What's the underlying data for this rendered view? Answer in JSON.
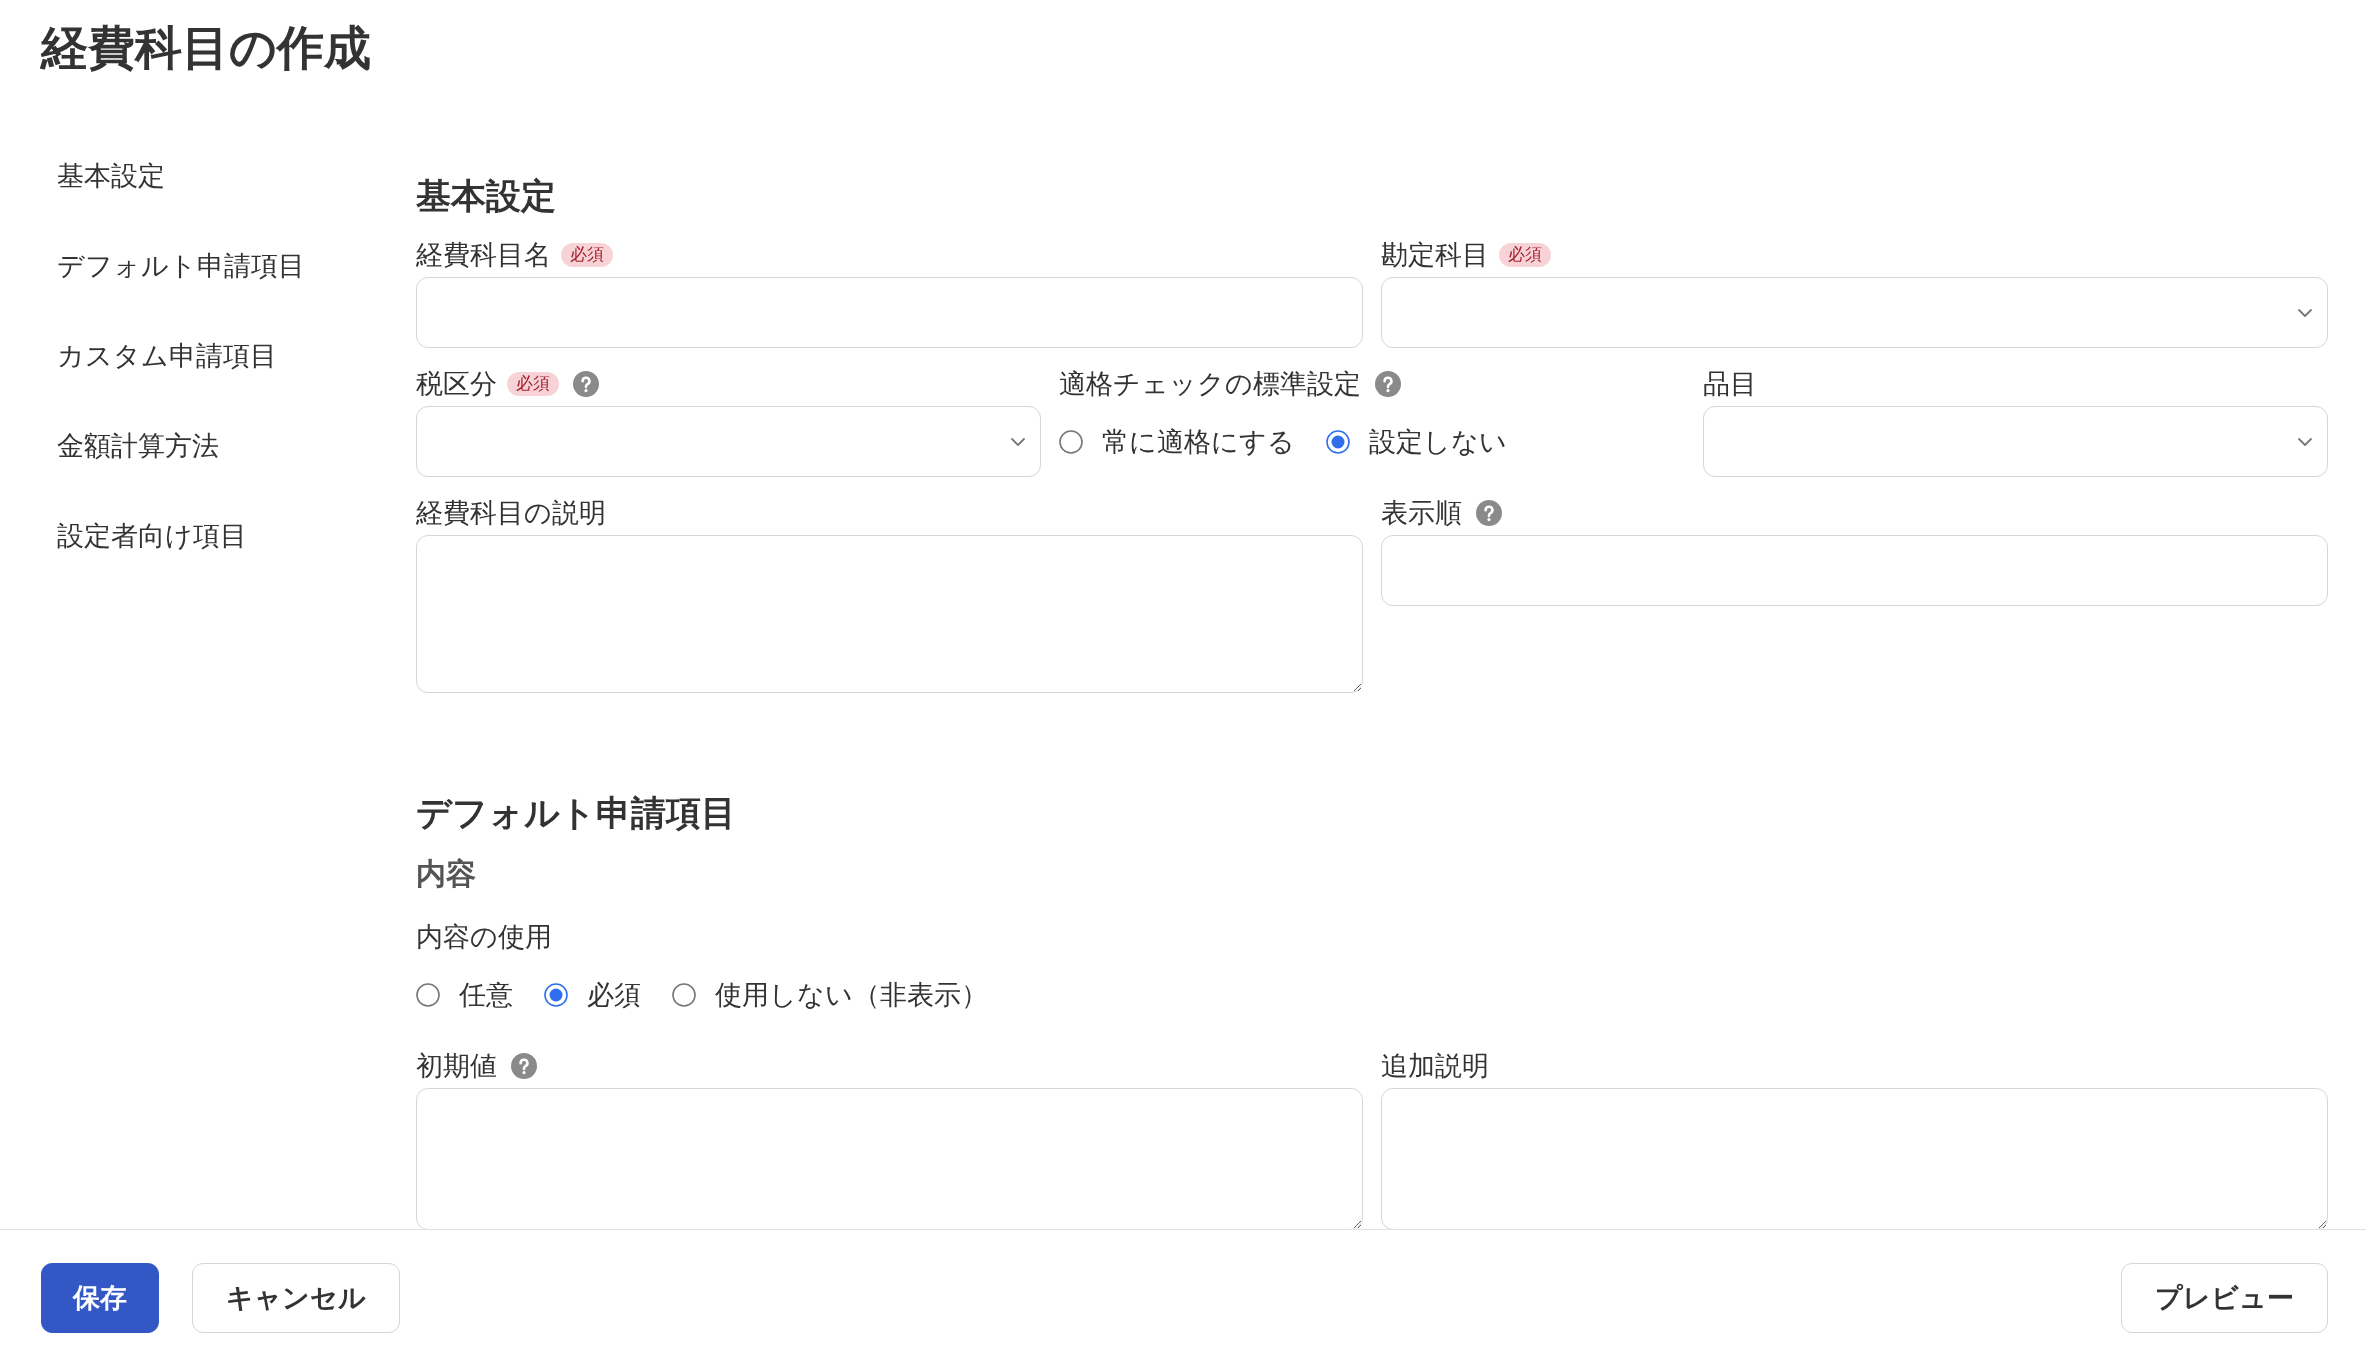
{
  "title": "経費科目の作成",
  "sidebar": {
    "items": [
      {
        "label": "基本設定"
      },
      {
        "label": "デフォルト申請項目"
      },
      {
        "label": "カスタム申請項目"
      },
      {
        "label": "金額計算方法"
      },
      {
        "label": "設定者向け項目"
      }
    ]
  },
  "sections": [
    {
      "heading": "基本設定",
      "groups": [
        {
          "rows": [
            {
              "fields": [
                {
                  "kind": "text",
                  "label": "経費科目名",
                  "required_badge": "必須"
                },
                {
                  "kind": "select",
                  "label": "勘定科目",
                  "required_badge": "必須"
                }
              ]
            },
            {
              "fields": [
                {
                  "kind": "select",
                  "label": "税区分",
                  "required_badge": "必須",
                  "help": true
                },
                {
                  "kind": "radio",
                  "label": "適格チェックの標準設定",
                  "help": true,
                  "options": [
                    {
                      "label": "常に適格にする",
                      "selected": false
                    },
                    {
                      "label": "設定しない",
                      "selected": true
                    }
                  ]
                },
                {
                  "kind": "select",
                  "label": "品目"
                }
              ]
            },
            {
              "fields": [
                {
                  "kind": "textarea",
                  "label": "経費科目の説明"
                },
                {
                  "kind": "text",
                  "label": "表示順",
                  "help": true
                }
              ]
            }
          ]
        }
      ]
    },
    {
      "heading": "デフォルト申請項目",
      "groups": [
        {
          "heading": "内容",
          "rows": [
            {
              "fields": [
                {
                  "kind": "radio",
                  "label": "内容の使用",
                  "options": [
                    {
                      "label": "任意",
                      "selected": false
                    },
                    {
                      "label": "必須",
                      "selected": true
                    },
                    {
                      "label": "使用しない（非表示）",
                      "selected": false
                    }
                  ]
                }
              ]
            },
            {
              "fields": [
                {
                  "kind": "textarea",
                  "label": "初期値",
                  "help": true
                },
                {
                  "kind": "textarea",
                  "label": "追加説明"
                }
              ]
            }
          ]
        }
      ]
    }
  ],
  "footer": {
    "left_buttons": [
      {
        "label": "保存",
        "kind": "primary"
      },
      {
        "label": "キャンセル",
        "kind": "secondary"
      }
    ],
    "right_buttons": [
      {
        "label": "プレビュー",
        "kind": "secondary"
      }
    ]
  }
}
